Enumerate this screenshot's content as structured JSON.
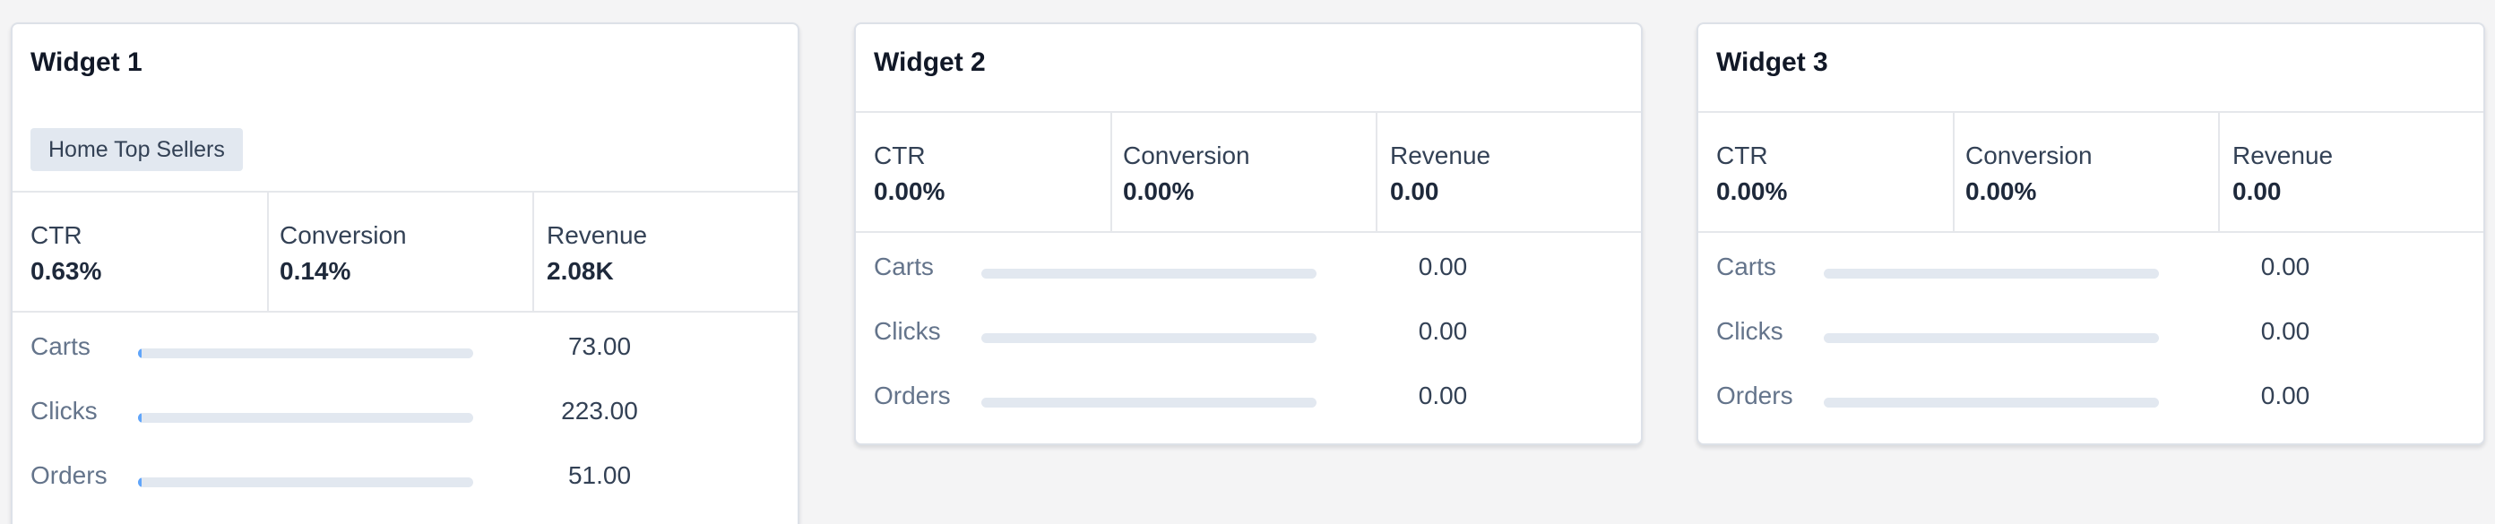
{
  "colors": {
    "accent": "#60a5fa",
    "track": "#e2e8f0",
    "tag_bg": "#e2e8f0",
    "card_bg": "#ffffff",
    "page_bg": "#f4f4f5"
  },
  "widgets": [
    {
      "title": "Widget 1",
      "tag": "Home Top Sellers",
      "stats": [
        {
          "label": "CTR",
          "value": "0.63%"
        },
        {
          "label": "Conversion",
          "value": "0.14%"
        },
        {
          "label": "Revenue",
          "value": "2.08K"
        }
      ],
      "metrics": [
        {
          "label": "Carts",
          "value": "73.00",
          "fill": 0.01
        },
        {
          "label": "Clicks",
          "value": "223.00",
          "fill": 0.01
        },
        {
          "label": "Orders",
          "value": "51.00",
          "fill": 0.01
        }
      ]
    },
    {
      "title": "Widget 2",
      "stats": [
        {
          "label": "CTR",
          "value": "0.00%"
        },
        {
          "label": "Conversion",
          "value": "0.00%"
        },
        {
          "label": "Revenue",
          "value": "0.00"
        }
      ],
      "metrics": [
        {
          "label": "Carts",
          "value": "0.00",
          "fill": 0
        },
        {
          "label": "Clicks",
          "value": "0.00",
          "fill": 0
        },
        {
          "label": "Orders",
          "value": "0.00",
          "fill": 0
        }
      ]
    },
    {
      "title": "Widget 3",
      "stats": [
        {
          "label": "CTR",
          "value": "0.00%"
        },
        {
          "label": "Conversion",
          "value": "0.00%"
        },
        {
          "label": "Revenue",
          "value": "0.00"
        }
      ],
      "metrics": [
        {
          "label": "Carts",
          "value": "0.00",
          "fill": 0
        },
        {
          "label": "Clicks",
          "value": "0.00",
          "fill": 0
        },
        {
          "label": "Orders",
          "value": "0.00",
          "fill": 0
        }
      ]
    }
  ]
}
